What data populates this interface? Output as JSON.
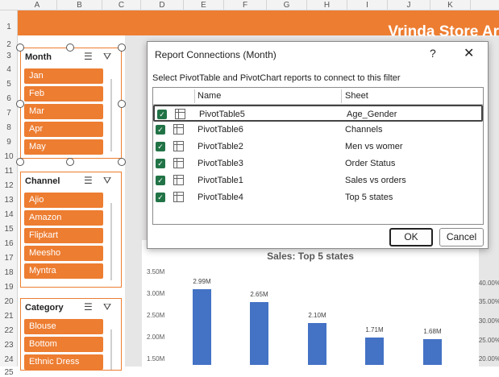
{
  "sheet": {
    "columns": [
      "A",
      "B",
      "C",
      "D",
      "E",
      "F",
      "G",
      "H",
      "I",
      "J",
      "K"
    ],
    "rows": [
      "1",
      "2",
      "3",
      "4",
      "5",
      "6",
      "7",
      "8",
      "9",
      "10",
      "11",
      "12",
      "13",
      "14",
      "15",
      "16",
      "17",
      "18",
      "19",
      "20",
      "21",
      "22",
      "23",
      "24",
      "25"
    ],
    "banner_title": "Vrinda Store Ar",
    "colors": {
      "accent": "#ed7d31",
      "bar": "#4472c4",
      "check": "#217346"
    }
  },
  "slicers": {
    "month": {
      "title": "Month",
      "items": [
        "Jan",
        "Feb",
        "Mar",
        "Apr",
        "May"
      ]
    },
    "channel": {
      "title": "Channel",
      "items": [
        "Ajio",
        "Amazon",
        "Flipkart",
        "Meesho",
        "Myntra"
      ]
    },
    "category": {
      "title": "Category",
      "items": [
        "Blouse",
        "Bottom",
        "Ethnic Dress"
      ]
    },
    "icons": [
      "multi-select-icon",
      "clear-filter-icon"
    ]
  },
  "dialog": {
    "title": "Report Connections (Month)",
    "help": "?",
    "close": "✕",
    "instruction": "Select PivotTable and PivotChart reports to connect to this filter",
    "columns": {
      "name": "Name",
      "sheet": "Sheet"
    },
    "rows": [
      {
        "name": "PivotTable5",
        "sheet": "Age_Gender",
        "checked": true
      },
      {
        "name": "PivotTable6",
        "sheet": "Channels",
        "checked": true
      },
      {
        "name": "PivotTable2",
        "sheet": "Men vs womer",
        "checked": true
      },
      {
        "name": "PivotTable3",
        "sheet": "Order Status",
        "checked": true
      },
      {
        "name": "PivotTable1",
        "sheet": "Sales vs orders",
        "checked": true
      },
      {
        "name": "PivotTable4",
        "sheet": "Top 5 states",
        "checked": true
      }
    ],
    "ok_label": "OK",
    "cancel_label": "Cancel"
  },
  "chart_data": {
    "type": "bar",
    "title": "Sales: Top 5 states",
    "values": [
      2.99,
      2.65,
      2.1,
      1.71,
      1.68
    ],
    "labels": [
      "2.99M",
      "2.65M",
      "2.10M",
      "1.71M",
      "1.68M"
    ],
    "y_ticks": [
      "3.50M",
      "3.00M",
      "2.50M",
      "2.00M",
      "1.50M"
    ],
    "y2_ticks": [
      "40.00%",
      "35.00%",
      "30.00%",
      "25.00%",
      "20.00%"
    ]
  }
}
